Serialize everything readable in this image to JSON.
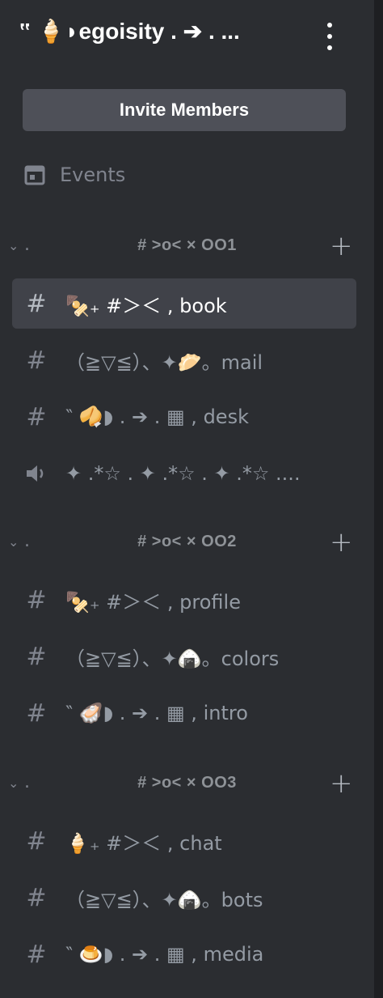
{
  "server": {
    "name": "‟ 🍦◗egoisity . ➔ . ..."
  },
  "invite": {
    "label": "Invite Members"
  },
  "events": {
    "label": "Events"
  },
  "categories": [
    {
      "name": "# >o< × OO1",
      "channels": [
        {
          "type": "text",
          "label": "🍢₊ #＞＜ , book",
          "active": true
        },
        {
          "type": "text",
          "label": "（≧▽≦）、✦🥟。mail",
          "active": false
        },
        {
          "type": "text",
          "label": "‶ 🥠◗ . ➔ . ▦ , desk",
          "active": false
        },
        {
          "type": "voice",
          "label": "✦ .*☆ . ✦ .*☆ . ✦ .*☆ ....",
          "active": false
        }
      ]
    },
    {
      "name": "# >o< × OO2",
      "channels": [
        {
          "type": "text",
          "label": "🍢₊ #＞＜ , profile",
          "active": false
        },
        {
          "type": "text",
          "label": "（≧▽≦）、✦🍙。colors",
          "active": false
        },
        {
          "type": "text",
          "label": "‶ 🦪◗ . ➔ . ▦ , intro",
          "active": false
        }
      ]
    },
    {
      "name": "# >o< × OO3",
      "channels": [
        {
          "type": "text",
          "label": "🍦₊ #＞＜ , chat",
          "active": false
        },
        {
          "type": "text",
          "label": "（≧▽≦）、✦🍙。bots",
          "active": false
        },
        {
          "type": "text",
          "label": "‶ 🍮◗ . ➔ . ▦ , media",
          "active": false
        }
      ]
    }
  ],
  "icons": {
    "kebab": "more-vertical-icon",
    "events": "calendar-icon",
    "text_channel": "hashtag-icon",
    "voice_channel": "speaker-icon",
    "collapse": "chevron-down-icon",
    "add": "plus-icon"
  },
  "colors": {
    "background": "#2b2d31",
    "active_channel": "#404249",
    "button": "#4e5058",
    "muted_text": "#949ba4"
  }
}
